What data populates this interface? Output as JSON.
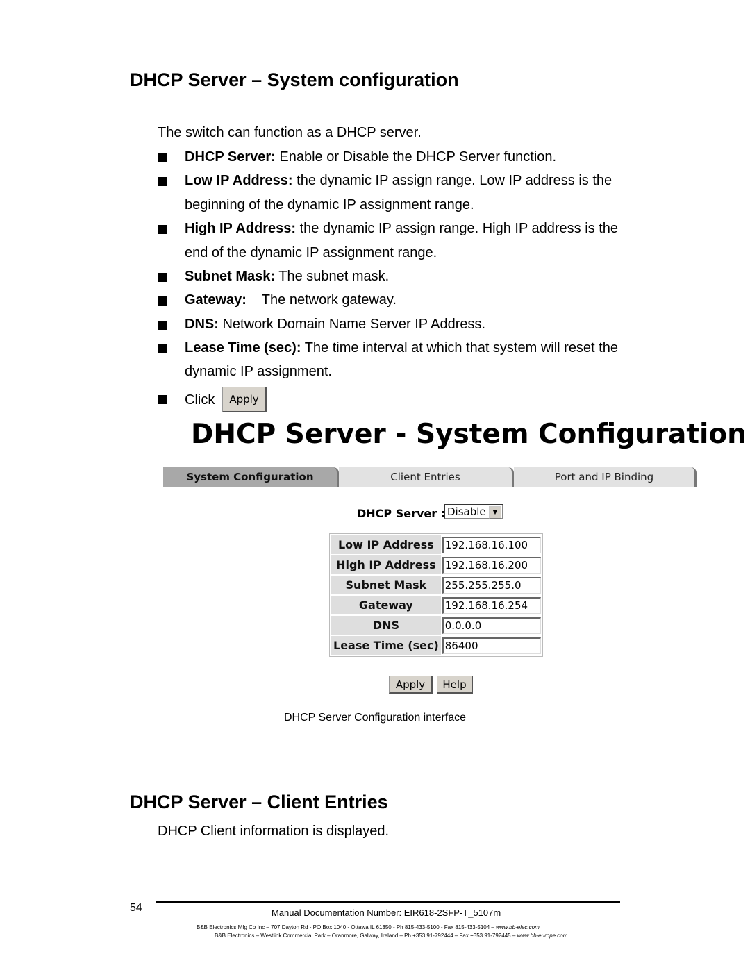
{
  "section1": {
    "title": "DHCP Server – System configuration",
    "intro": "The switch can function as a DHCP server.",
    "bullets": [
      {
        "term": "DHCP Server:",
        "text": " Enable or Disable the DHCP Server function."
      },
      {
        "term": "Low IP Address:",
        "text": " the dynamic IP assign range. Low IP address is the",
        "cont": "beginning of the dynamic IP assignment range."
      },
      {
        "term": "High IP Address:",
        "text": " the dynamic IP assign range. High IP address is the",
        "cont": "end of the dynamic IP assignment range."
      },
      {
        "term": "Subnet Mask:",
        "text": " The subnet mask."
      },
      {
        "term": "Gateway:",
        "text": "    The network gateway."
      },
      {
        "term": "DNS:",
        "text": " Network Domain Name Server IP Address."
      },
      {
        "term": "Lease Time (sec):",
        "text": " The time interval at which that system will reset the",
        "cont": "dynamic IP assignment."
      }
    ],
    "click_label": "Click",
    "apply_label": "Apply"
  },
  "screenshot": {
    "title": "DHCP Server - System Configuration",
    "tabs": [
      {
        "label": "System Configuration",
        "active": true
      },
      {
        "label": "Client Entries"
      },
      {
        "label": "Port and IP Binding"
      }
    ],
    "dhcp_server_label": "DHCP Server :",
    "dhcp_server_value": "Disable",
    "fields": [
      {
        "label": "Low IP Address",
        "value": "192.168.16.100"
      },
      {
        "label": "High IP Address",
        "value": "192.168.16.200"
      },
      {
        "label": "Subnet Mask",
        "value": "255.255.255.0"
      },
      {
        "label": "Gateway",
        "value": "192.168.16.254"
      },
      {
        "label": "DNS",
        "value": "0.0.0.0"
      },
      {
        "label": "Lease Time (sec)",
        "value": "86400"
      }
    ],
    "apply": "Apply",
    "help": "Help"
  },
  "caption": "DHCP Server Configuration interface",
  "section2": {
    "title": "DHCP Server – Client Entries",
    "intro": "DHCP Client information is displayed."
  },
  "footer": {
    "page_number": "54",
    "doc_number": "Manual Documentation Number: EIR618-2SFP-T_5107m",
    "line1": "B&B Electronics Mfg Co Inc – 707 Dayton Rd - PO Box 1040 - Ottawa IL 61350 - Ph 815-433-5100 - Fax 815-433-5104 – ",
    "url1": "www.bb-elec.com",
    "line2": "B&B Electronics – Westlink Commercial Park – Oranmore, Galway, Ireland – Ph +353 91-792444 – Fax +353 91-792445 – ",
    "url2": "www.bb-europe.com"
  }
}
